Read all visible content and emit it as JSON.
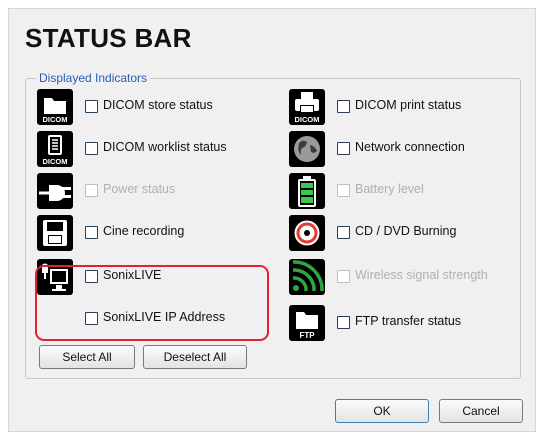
{
  "dialog": {
    "title": "STATUS BAR",
    "group_label": "Displayed Indicators"
  },
  "indicators": {
    "dicom_store": {
      "label": "DICOM store status",
      "icon": "folder-dicom-icon",
      "checked": false,
      "enabled": true
    },
    "dicom_worklist": {
      "label": "DICOM worklist status",
      "icon": "worklist-dicom-icon",
      "checked": false,
      "enabled": true
    },
    "power": {
      "label": "Power status",
      "icon": "power-plug-icon",
      "checked": false,
      "enabled": false
    },
    "cine": {
      "label": "Cine recording",
      "icon": "disk-save-icon",
      "checked": false,
      "enabled": true
    },
    "sonixlive": {
      "label": "SonixLIVE",
      "icon": "sonixlive-monitor-icon",
      "checked": false,
      "enabled": true
    },
    "sonixlive_ip": {
      "label": "SonixLIVE IP Address",
      "checked": false,
      "enabled": true
    },
    "dicom_print": {
      "label": "DICOM print status",
      "icon": "printer-dicom-icon",
      "checked": false,
      "enabled": true
    },
    "network": {
      "label": "Network connection",
      "icon": "globe-network-icon",
      "checked": false,
      "enabled": true
    },
    "battery": {
      "label": "Battery level",
      "icon": "battery-icon",
      "checked": false,
      "enabled": false
    },
    "cd_dvd": {
      "label": "CD / DVD Burning",
      "icon": "disc-burning-icon",
      "checked": false,
      "enabled": true
    },
    "wireless": {
      "label": "Wireless signal strength",
      "icon": "wireless-signal-icon",
      "checked": false,
      "enabled": false
    },
    "ftp": {
      "label": "FTP transfer status",
      "icon": "folder-ftp-icon",
      "checked": false,
      "enabled": true
    }
  },
  "icon_text": {
    "dicom": "DICOM",
    "ftp": "FTP"
  },
  "buttons": {
    "select_all": "Select All",
    "deselect_all": "Deselect All",
    "ok": "OK",
    "cancel": "Cancel"
  },
  "colors": {
    "highlight": "#e32230",
    "group_label": "#2a5cb8",
    "battery_green": "#3cc84a",
    "wireless_green": "#2fa63c",
    "disabled_text": "#b0b0b0"
  }
}
